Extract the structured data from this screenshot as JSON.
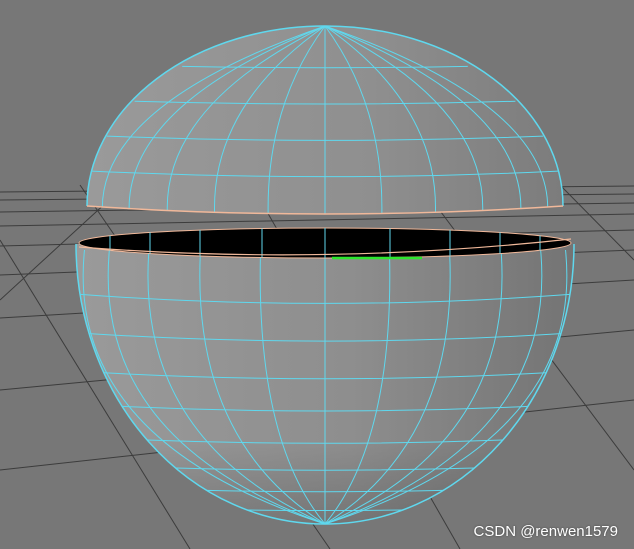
{
  "viewport": {
    "background_color": "#777777",
    "grid_color": "#3c3c3c",
    "wireframe_color": "#5fd8ee",
    "edge_highlight_color": "#f0b89a",
    "selected_edge_color": "#2ee62e",
    "interior_color": "#000000",
    "surface_color": "#8c8c8c"
  },
  "scene": {
    "objects": [
      {
        "name": "sphere-upper-half",
        "wireframe": true
      },
      {
        "name": "sphere-lower-half",
        "wireframe": true
      }
    ]
  },
  "watermark": {
    "text": "CSDN @renwen1579"
  }
}
